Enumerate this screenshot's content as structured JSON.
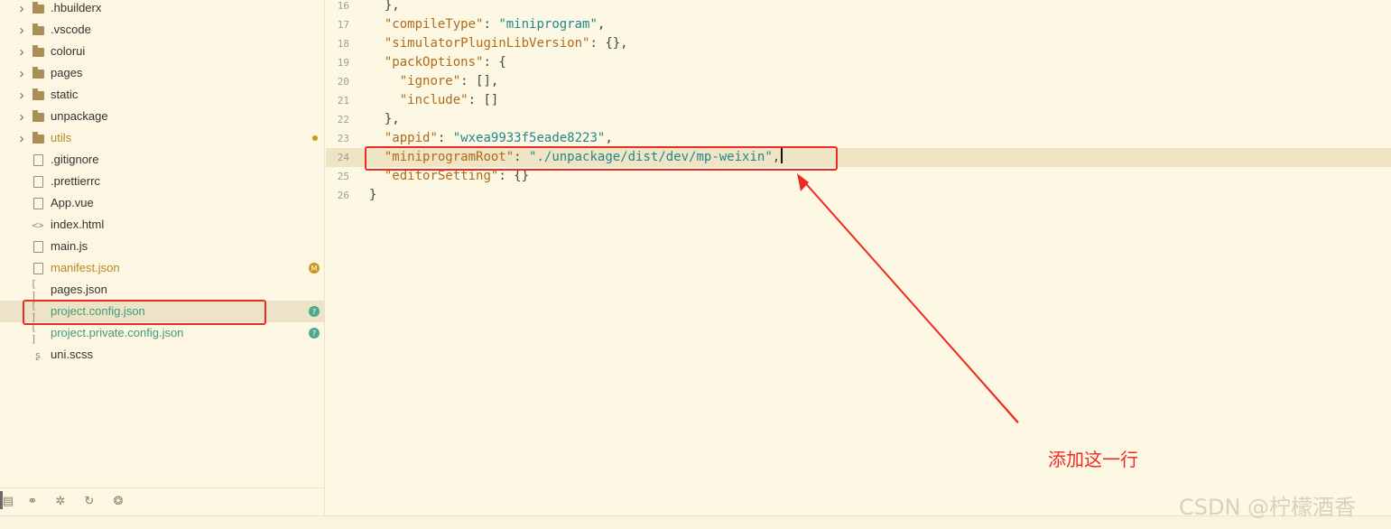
{
  "sidebar": {
    "items": [
      {
        "label": ".hbuilderx",
        "type": "folder",
        "status": "plain",
        "icon": "folder-icon"
      },
      {
        "label": ".vscode",
        "type": "folder",
        "status": "plain",
        "icon": "folder-icon"
      },
      {
        "label": "colorui",
        "type": "folder",
        "status": "plain",
        "icon": "folder-icon"
      },
      {
        "label": "pages",
        "type": "folder",
        "status": "plain",
        "icon": "folder-icon"
      },
      {
        "label": "static",
        "type": "folder",
        "status": "plain",
        "icon": "folder-icon"
      },
      {
        "label": "unpackage",
        "type": "folder",
        "status": "plain",
        "icon": "folder-icon"
      },
      {
        "label": "utils",
        "type": "folder",
        "status": "mod",
        "icon": "folder-icon"
      },
      {
        "label": ".gitignore",
        "type": "file",
        "status": "plain",
        "icon": "file-icon"
      },
      {
        "label": ".prettierrc",
        "type": "file",
        "status": "plain",
        "icon": "file-icon"
      },
      {
        "label": "App.vue",
        "type": "file",
        "status": "plain",
        "icon": "vue-file-icon"
      },
      {
        "label": "index.html",
        "type": "file",
        "status": "plain",
        "icon": "html-file-icon"
      },
      {
        "label": "main.js",
        "type": "file",
        "status": "plain",
        "icon": "js-file-icon"
      },
      {
        "label": "manifest.json",
        "type": "file",
        "status": "mod",
        "icon": "settings-file-icon",
        "badge": "M"
      },
      {
        "label": "pages.json",
        "type": "file",
        "status": "plain",
        "icon": "json-file-icon"
      },
      {
        "label": "project.config.json",
        "type": "file",
        "status": "new",
        "icon": "json-file-icon",
        "badge": "?"
      },
      {
        "label": "project.private.config.json",
        "type": "file",
        "status": "new",
        "icon": "json-file-icon",
        "badge": "?"
      },
      {
        "label": "uni.scss",
        "type": "file",
        "status": "plain",
        "icon": "scss-file-icon"
      }
    ],
    "toolbar": [
      "project-icon",
      "binoculars-icon",
      "bug-icon",
      "refresh-search-icon",
      "plugin-icon"
    ]
  },
  "editor": {
    "lines": [
      {
        "no": "16",
        "text": "  },"
      },
      {
        "no": "17",
        "key": "compileType",
        "value": "\"miniprogram\"",
        "suffix": ","
      },
      {
        "no": "18",
        "key": "simulatorPluginLibVersion",
        "value": "{}",
        "suffix": ","
      },
      {
        "no": "19",
        "key": "packOptions",
        "value": "{",
        "suffix": ""
      },
      {
        "no": "20",
        "key": "ignore",
        "value": "[]",
        "suffix": ",",
        "indent": 2
      },
      {
        "no": "21",
        "key": "include",
        "value": "[]",
        "suffix": "",
        "indent": 2
      },
      {
        "no": "22",
        "text": "  },"
      },
      {
        "no": "23",
        "key": "appid",
        "value": "\"wxea9933f5eade8223\"",
        "suffix": ","
      },
      {
        "no": "24",
        "key": "miniprogramRoot",
        "value": "\"./unpackage/dist/dev/mp-weixin\"",
        "suffix": ",",
        "current": true
      },
      {
        "no": "25",
        "key": "editorSetting",
        "value": "{}",
        "suffix": ""
      },
      {
        "no": "26",
        "text": "}"
      }
    ]
  },
  "annotation": {
    "text": "添加这一行",
    "color": "#ee2a24"
  },
  "watermark": "CSDN @柠檬酒香"
}
